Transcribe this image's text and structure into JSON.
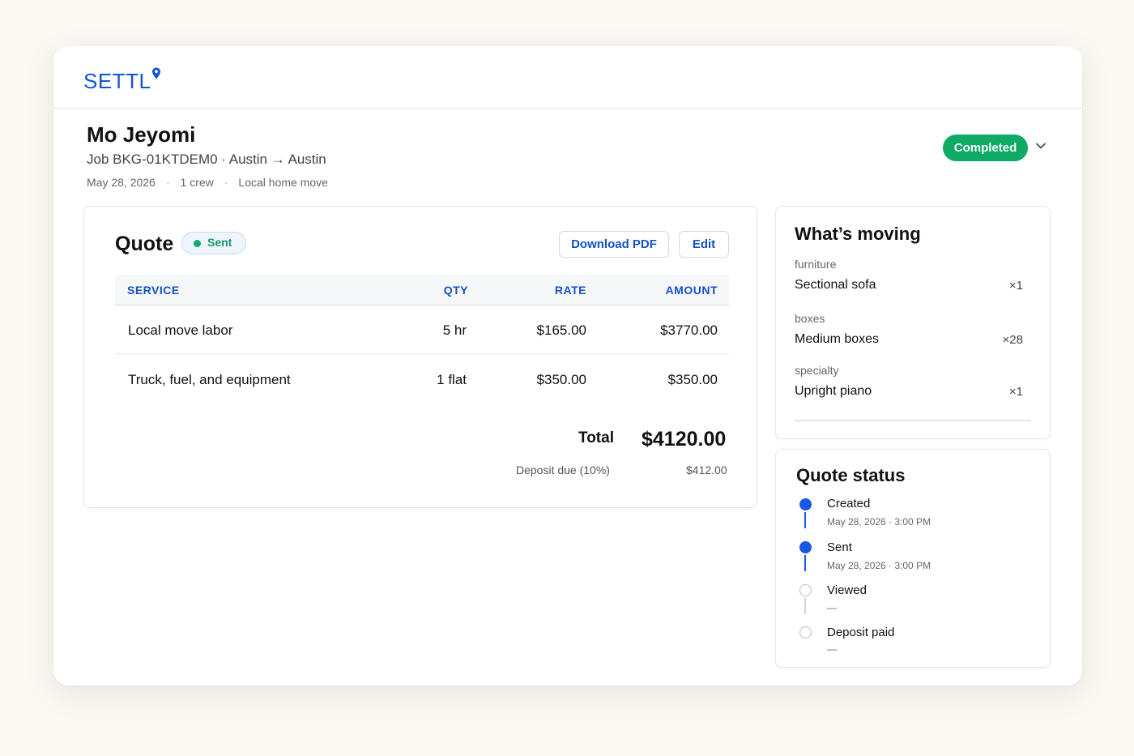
{
  "brand": {
    "name": "SETTL",
    "color": "#1255d6"
  },
  "job": {
    "customer_name": "Mo Jeyomi",
    "job_line": "Job BKG-01KTDEM0 · Austin → Austin",
    "date": "May 28, 2026",
    "crew": "1 crew",
    "move_type": "Local home move",
    "status": "Completed",
    "status_color": "#0eaa66"
  },
  "quote": {
    "title": "Quote",
    "badge": "Sent",
    "download_label": "Download PDF",
    "edit_label": "Edit",
    "columns": {
      "service": "SERVICE",
      "qty": "QTY",
      "rate": "RATE",
      "amount": "AMOUNT"
    },
    "rows": [
      {
        "service": "Local move labor",
        "qty": "5 hr",
        "rate": "$165.00",
        "amount": "$3770.00"
      },
      {
        "service": "Truck, fuel, and equipment",
        "qty": "1 flat",
        "rate": "$350.00",
        "amount": "$350.00"
      }
    ],
    "total_label": "Total",
    "total_value": "$4120.00",
    "deposit_label": "Deposit due (10%)",
    "deposit_value": "$412.00"
  },
  "moving": {
    "title": "What’s moving",
    "items": [
      {
        "category": "furniture",
        "name": "Sectional sofa",
        "qty": "×1"
      },
      {
        "category": "boxes",
        "name": "Medium boxes",
        "qty": "×28"
      },
      {
        "category": "specialty",
        "name": "Upright piano",
        "qty": "×1"
      }
    ]
  },
  "quote_status": {
    "title": "Quote status",
    "steps": [
      {
        "label": "Created",
        "time": "May 28, 2026 · 3:00 PM",
        "done": true
      },
      {
        "label": "Sent",
        "time": "May 28, 2026 · 3:00 PM",
        "done": true
      },
      {
        "label": "Viewed",
        "time": "—",
        "done": false
      },
      {
        "label": "Deposit paid",
        "time": "—",
        "done": false
      }
    ]
  }
}
